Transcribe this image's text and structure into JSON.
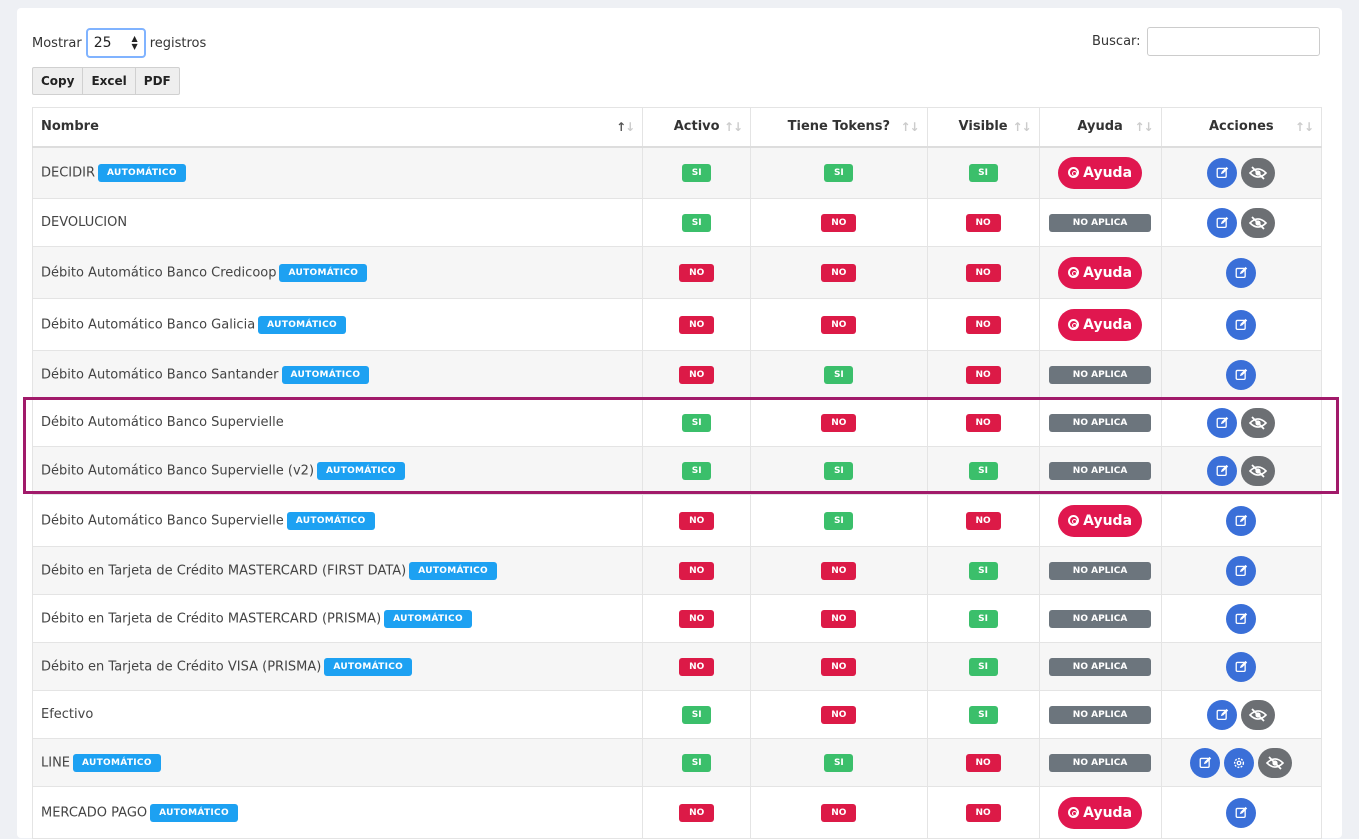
{
  "controls": {
    "show_label": "Mostrar",
    "page_size": "25",
    "records_label": "registros",
    "export_buttons": [
      "Copy",
      "Excel",
      "PDF"
    ],
    "search_label": "Buscar:",
    "search_value": ""
  },
  "columns": [
    "Nombre",
    "Activo",
    "Tiene Tokens?",
    "Visible",
    "Ayuda",
    "Acciones"
  ],
  "auto_tag": "AUTOMÁTICO",
  "ayuda_label": "Ayuda",
  "no_aplica_label": "NO APLICA",
  "colors": {
    "si": "#3bbf6b",
    "no": "#dc1a47",
    "no_aplica": "#6c757d",
    "ayuda": "#e0174f",
    "auto_tag": "#1da1f2",
    "edit": "#3a6fd8",
    "hide": "#6c6f73",
    "highlight": "#a11a6a"
  },
  "rows": [
    {
      "name": "DECIDIR",
      "auto": true,
      "activo": "SI",
      "tokens": "SI",
      "visible": "SI",
      "ayuda": "button",
      "actions": [
        "edit",
        "hide"
      ]
    },
    {
      "name": "DEVOLUCION",
      "auto": false,
      "activo": "SI",
      "tokens": "NO",
      "visible": "NO",
      "ayuda": "na",
      "actions": [
        "edit",
        "hide"
      ]
    },
    {
      "name": "Débito Automático Banco Credicoop",
      "auto": true,
      "activo": "NO",
      "tokens": "NO",
      "visible": "NO",
      "ayuda": "button",
      "actions": [
        "edit"
      ]
    },
    {
      "name": "Débito Automático Banco Galicia",
      "auto": true,
      "activo": "NO",
      "tokens": "NO",
      "visible": "NO",
      "ayuda": "button",
      "actions": [
        "edit"
      ]
    },
    {
      "name": "Débito Automático Banco Santander",
      "auto": true,
      "activo": "NO",
      "tokens": "SI",
      "visible": "NO",
      "ayuda": "na",
      "actions": [
        "edit"
      ]
    },
    {
      "name": "Débito Automático Banco Supervielle",
      "auto": false,
      "activo": "SI",
      "tokens": "NO",
      "visible": "NO",
      "ayuda": "na",
      "actions": [
        "edit",
        "hide"
      ]
    },
    {
      "name": "Débito Automático Banco Supervielle (v2)",
      "auto": true,
      "activo": "SI",
      "tokens": "SI",
      "visible": "SI",
      "ayuda": "na",
      "actions": [
        "edit",
        "hide"
      ]
    },
    {
      "name": "Débito Automático Banco Supervielle",
      "auto": true,
      "activo": "NO",
      "tokens": "SI",
      "visible": "NO",
      "ayuda": "button",
      "actions": [
        "edit"
      ]
    },
    {
      "name": "Débito en Tarjeta de Crédito MASTERCARD (FIRST DATA)",
      "auto": true,
      "activo": "NO",
      "tokens": "NO",
      "visible": "SI",
      "ayuda": "na",
      "actions": [
        "edit"
      ]
    },
    {
      "name": "Débito en Tarjeta de Crédito MASTERCARD (PRISMA)",
      "auto": true,
      "activo": "NO",
      "tokens": "NO",
      "visible": "SI",
      "ayuda": "na",
      "actions": [
        "edit"
      ]
    },
    {
      "name": "Débito en Tarjeta de Crédito VISA (PRISMA)",
      "auto": true,
      "activo": "NO",
      "tokens": "NO",
      "visible": "SI",
      "ayuda": "na",
      "actions": [
        "edit"
      ]
    },
    {
      "name": "Efectivo",
      "auto": false,
      "activo": "SI",
      "tokens": "NO",
      "visible": "SI",
      "ayuda": "na",
      "actions": [
        "edit",
        "hide"
      ]
    },
    {
      "name": "LINE",
      "auto": true,
      "activo": "SI",
      "tokens": "SI",
      "visible": "NO",
      "ayuda": "na",
      "actions": [
        "edit",
        "gear",
        "hide"
      ]
    },
    {
      "name": "MERCADO PAGO",
      "auto": true,
      "activo": "NO",
      "tokens": "NO",
      "visible": "NO",
      "ayuda": "button",
      "actions": [
        "edit"
      ]
    }
  ]
}
